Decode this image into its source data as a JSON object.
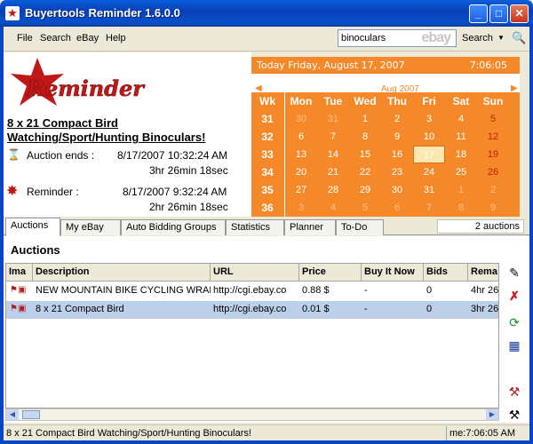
{
  "window": {
    "title": "Buyertools Reminder 1.6.0.0"
  },
  "menu": {
    "items": [
      "File",
      "Search",
      "eBay",
      "Help"
    ]
  },
  "search": {
    "value": "binoculars",
    "ghost": "ebay",
    "label": "Search"
  },
  "logo": {
    "text": "Reminder"
  },
  "item": {
    "title": "8 x 21 Compact Bird Watching/Sport/Hunting Binoculars!",
    "auction_ends_label": "Auction ends :",
    "auction_ends_date": "8/17/2007 10:32:24 AM",
    "auction_ends_remaining": "3hr 26min 18sec",
    "reminder_label": "Reminder :",
    "reminder_date": "8/17/2007 9:32:24 AM",
    "reminder_remaining": "2hr 26min 18sec"
  },
  "calendar": {
    "today_text": "Today Friday, August 17, 2007",
    "clock": "7:06:05",
    "month": "Aug 2007",
    "headers": [
      "Wk",
      "Mon",
      "Tue",
      "Wed",
      "Thu",
      "Fri",
      "Sat",
      "Sun"
    ],
    "weeks": [
      {
        "wk": "31",
        "days": [
          "30",
          "31",
          "1",
          "2",
          "3",
          "4",
          "5"
        ]
      },
      {
        "wk": "32",
        "days": [
          "6",
          "7",
          "8",
          "9",
          "10",
          "11",
          "12"
        ]
      },
      {
        "wk": "33",
        "days": [
          "13",
          "14",
          "15",
          "16",
          "17",
          "18",
          "19"
        ]
      },
      {
        "wk": "34",
        "days": [
          "20",
          "21",
          "22",
          "23",
          "24",
          "25",
          "26"
        ]
      },
      {
        "wk": "35",
        "days": [
          "27",
          "28",
          "29",
          "30",
          "31",
          "1",
          "2"
        ]
      },
      {
        "wk": "36",
        "days": [
          "3",
          "4",
          "5",
          "6",
          "7",
          "8",
          "9"
        ]
      }
    ],
    "today_day": "17",
    "colors": {
      "accent": "#f5892a",
      "sunday": "#c0200e"
    }
  },
  "tabs": [
    "Auctions",
    "My eBay",
    "Auto Bidding Groups",
    "Statistics",
    "Planner",
    "To-Do"
  ],
  "active_tab": "Auctions",
  "auction_count": "2 auctions",
  "section_title": "Auctions",
  "table": {
    "columns": [
      "Ima",
      "Description",
      "URL",
      "Price",
      "Buy It Now",
      "Bids",
      "Rema"
    ],
    "rows": [
      [
        "",
        "NEW MOUNTAIN BIKE CYCLING WRAP",
        "http://cgi.ebay.co",
        "0.88 $",
        "-",
        "0",
        "4hr 26"
      ],
      [
        "",
        "8 x 21 Compact Bird",
        "http://cgi.ebay.co",
        "0.01 $",
        "-",
        "0",
        "3hr 26"
      ]
    ]
  },
  "status": {
    "left": "8 x 21 Compact Bird Watching/Sport/Hunting Binoculars!",
    "right": "me:7:06:05 AM"
  }
}
